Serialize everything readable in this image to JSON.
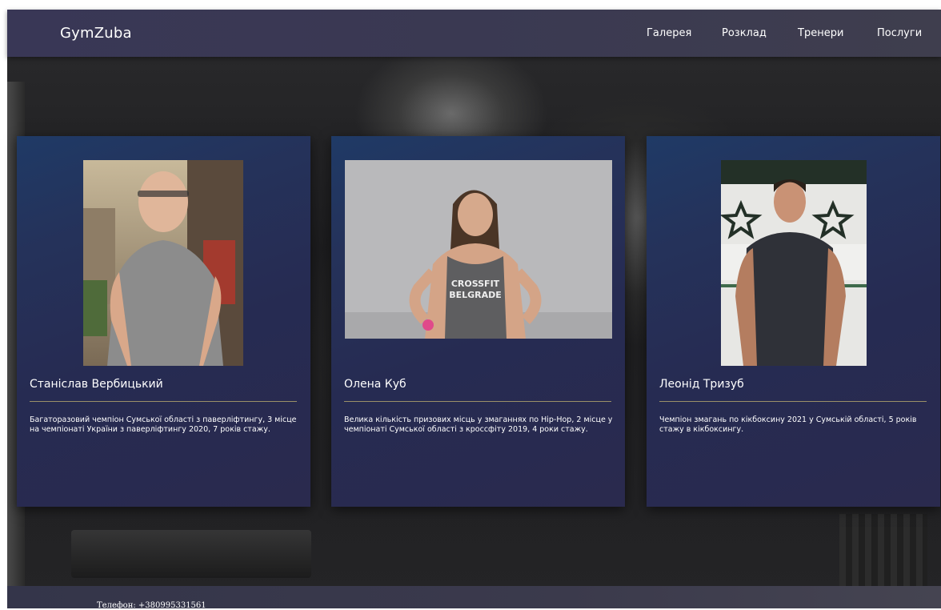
{
  "header": {
    "logo": "GymZuba",
    "nav": [
      {
        "label": "Галерея"
      },
      {
        "label": "Розклад"
      },
      {
        "label": "Тренери"
      },
      {
        "label": "Послуги"
      }
    ]
  },
  "trainers": [
    {
      "name": "Станіслав Вербицький",
      "description": "Багаторазовий чемпіон Сумської області з паверліфтингу, 3 місце на чемпіонаті України з паверліфтингу 2020, 7 років стажу."
    },
    {
      "name": "Олена Куб",
      "description": "Велика кількість призових місць у змаганнях по Hip-Hop, 2 місце у чемпіонаті Сумської області з кроссфіту 2019, 4 роки стажу.",
      "shirt_text": [
        "CROSSFIT",
        "BELGRADE"
      ]
    },
    {
      "name": "Леонід Тризуб",
      "description": "Чемпіон змагань по кікбоксину 2021 у Сумській області, 5 років стажу в кікбоксингу."
    }
  ],
  "footer": {
    "phone": "Телефон: +380995331561"
  },
  "colors": {
    "header_bg": "#393756",
    "card_bg": "#262b52",
    "divider": "#9a9068",
    "text": "#ffffff"
  }
}
